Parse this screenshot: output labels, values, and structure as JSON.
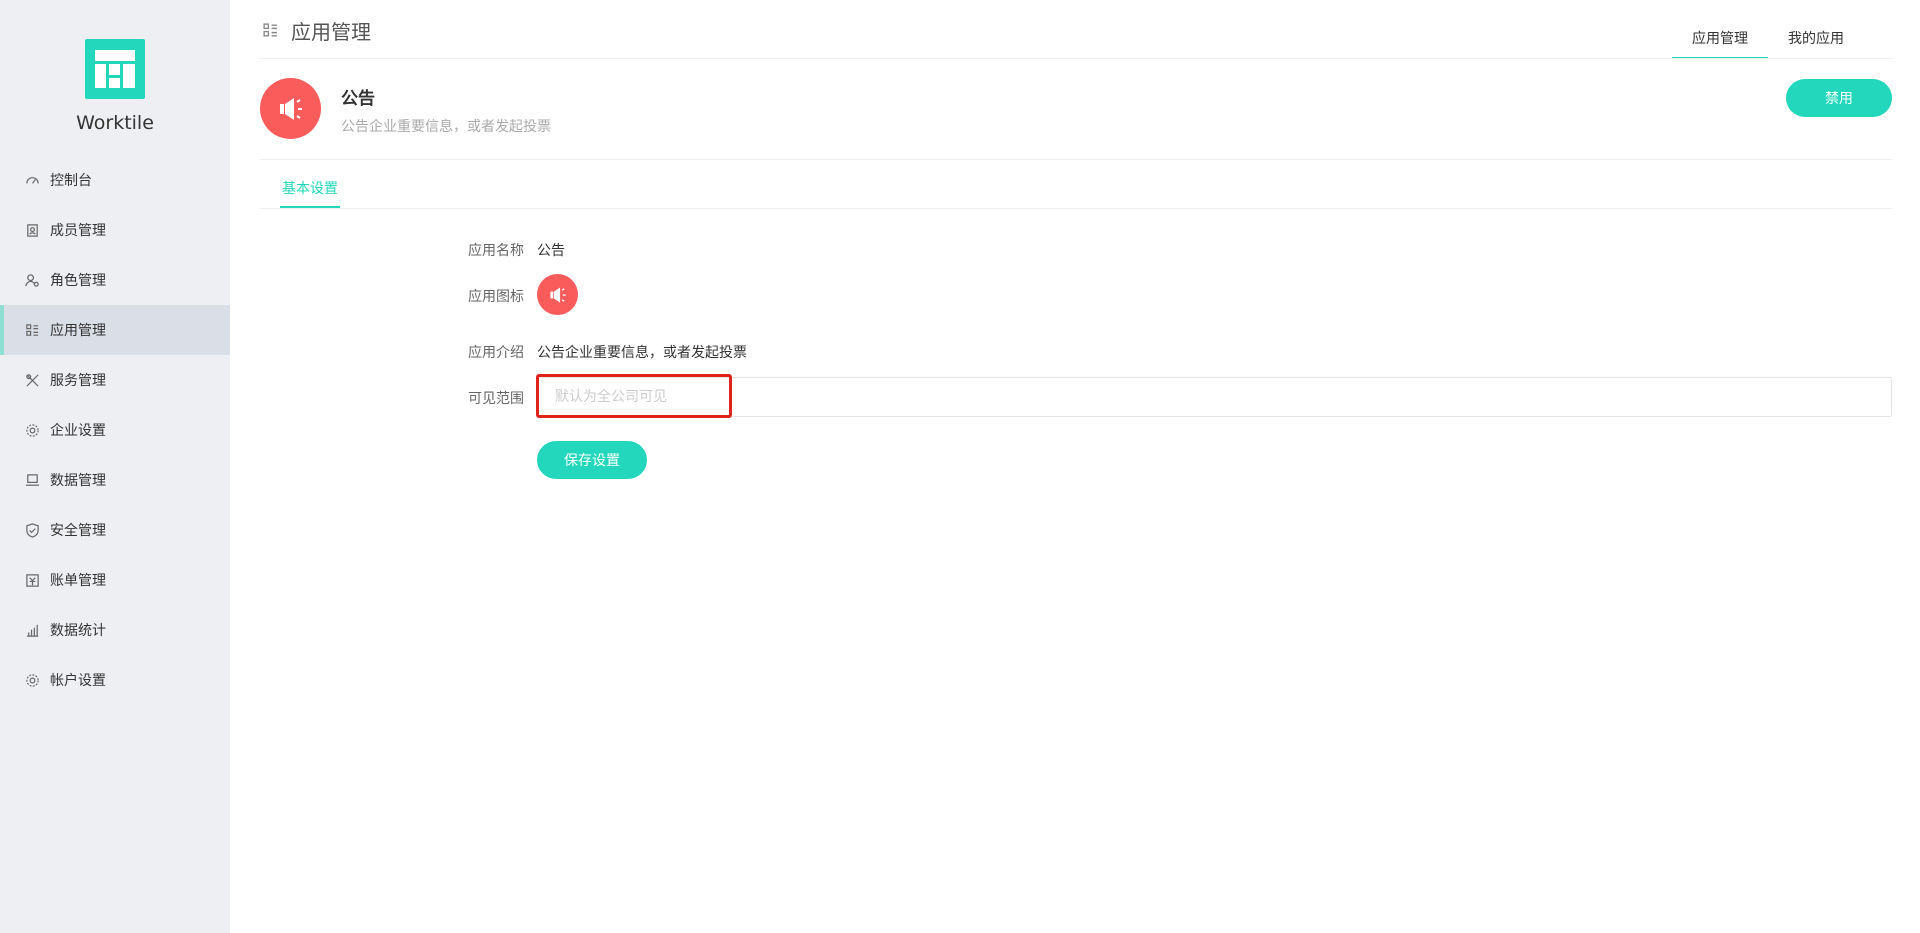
{
  "brand": {
    "name": "Worktile"
  },
  "sidebar": {
    "items": [
      {
        "label": "控制台",
        "icon": "dashboard-icon"
      },
      {
        "label": "成员管理",
        "icon": "member-icon"
      },
      {
        "label": "角色管理",
        "icon": "role-icon"
      },
      {
        "label": "应用管理",
        "icon": "apps-icon",
        "active": true
      },
      {
        "label": "服务管理",
        "icon": "tools-icon"
      },
      {
        "label": "企业设置",
        "icon": "gear-icon"
      },
      {
        "label": "数据管理",
        "icon": "database-icon"
      },
      {
        "label": "安全管理",
        "icon": "shield-icon"
      },
      {
        "label": "账单管理",
        "icon": "bill-icon"
      },
      {
        "label": "数据统计",
        "icon": "chart-icon"
      },
      {
        "label": "帐户设置",
        "icon": "gear-icon"
      }
    ]
  },
  "header": {
    "title": "应用管理",
    "tabs": [
      {
        "label": "应用管理",
        "active": true
      },
      {
        "label": "我的应用",
        "active": false
      }
    ]
  },
  "app": {
    "name": "公告",
    "description": "公告企业重要信息，或者发起投票",
    "disable_label": "禁用",
    "icon": "megaphone-icon"
  },
  "sub_tabs": [
    {
      "label": "基本设置",
      "active": true
    }
  ],
  "form": {
    "name_label": "应用名称",
    "name_value": "公告",
    "icon_label": "应用图标",
    "intro_label": "应用介绍",
    "intro_value": "公告企业重要信息，或者发起投票",
    "scope_label": "可见范围",
    "scope_placeholder": "默认为全公司可见",
    "scope_value": "",
    "save_label": "保存设置"
  },
  "colors": {
    "accent": "#22d7bb",
    "app_icon": "#fa5b5b",
    "highlight": "#e1241b",
    "sidebar_bg": "#edeff3"
  }
}
